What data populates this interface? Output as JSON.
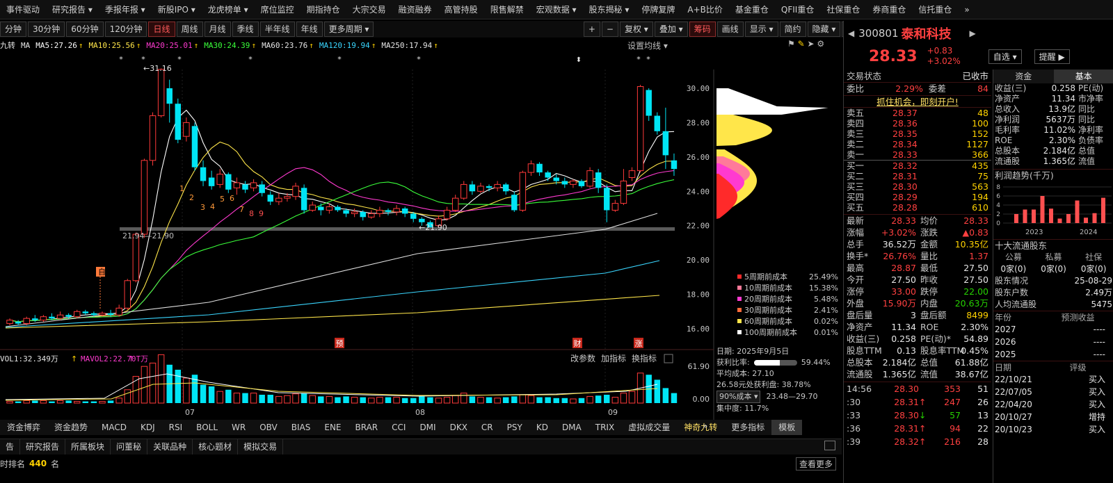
{
  "menu": [
    "事件驱动",
    "研究报告 ▾",
    "季报年报 ▾",
    "新股IPO ▾",
    "龙虎榜单 ▾",
    "席位监控",
    "期指持仓",
    "大宗交易",
    "融资融券",
    "高管持股",
    "限售解禁",
    "宏观数据 ▾",
    "股东揭秘 ▾",
    "停牌复牌",
    "A+B比价",
    "基金重仓",
    "QFII重仓",
    "社保重仓",
    "券商重仓",
    "信托重仓",
    "»"
  ],
  "periods": [
    "分钟",
    "30分钟",
    "60分钟",
    "120分钟",
    "日线",
    "周线",
    "月线",
    "季线",
    "半年线",
    "年线",
    "更多周期 ▾"
  ],
  "tools": [
    "+",
    "−",
    "复权 ▾",
    "叠加 ▾",
    "筹码",
    "画线",
    "显示 ▾",
    "简约",
    "隐藏 ▾",
    "⤡"
  ],
  "ma": {
    "prefix": "九转",
    "ma": "MA",
    "ma5": "MA5:27.26",
    "ma10": "MA10:25.56",
    "ma20": "MA20:25.01",
    "ma30": "MA30:24.39",
    "ma60": "MA60:23.76",
    "ma120": "MA120:19.94",
    "ma250": "MA250:17.94",
    "setup": "设置均线 ▾"
  },
  "chart_data": {
    "type": "candlestick",
    "y_ticks": [
      "30.00",
      "28.00",
      "26.00",
      "24.00",
      "22.00",
      "20.00",
      "18.00",
      "16.00"
    ],
    "x_ticks": [
      "07",
      "08",
      "09"
    ],
    "annotations": {
      "high": "31.16",
      "low": "21.90",
      "range": "21.94—21.90",
      "markers": [
        "预",
        "财",
        "涨"
      ],
      "self": "自",
      "nums": [
        "1",
        "2",
        "3",
        "4",
        "5",
        "6",
        "7",
        "8",
        "9"
      ]
    },
    "vol_label": "VOL1:32.349万",
    "mavol_label": "MAVOL2:22.70T万",
    "vol_ticks": [
      "61.90",
      "0.00"
    ],
    "vol_tools": [
      "改参数",
      "加指标",
      "换指标"
    ]
  },
  "chip_legend": [
    {
      "label": "5周期前成本",
      "value": "25.49%",
      "color": "#ff2a2a"
    },
    {
      "label": "10周期前成本",
      "value": "15.38%",
      "color": "#ff7a9a"
    },
    {
      "label": "20周期前成本",
      "value": "5.48%",
      "color": "#ff3ad0"
    },
    {
      "label": "30周期前成本",
      "value": "2.41%",
      "color": "#ff6a3a"
    },
    {
      "label": "60周期前成本",
      "value": "0.02%",
      "color": "#ffe64a"
    },
    {
      "label": "100周期前成本",
      "value": "0.01%",
      "color": "#ffffff"
    }
  ],
  "chip_info": {
    "date": "日期: 2025年9月5日",
    "profit_label": "获利比率:",
    "profit": "59.44%",
    "profit_pct": 0.5944,
    "avgcost": "平均成本: 27.10",
    "profit2": "26.58元处获利盘: 38.78%",
    "cost_sel": "90%成本 ▾",
    "cost_range": "23.48—29.70",
    "concentration": "集中度: 11.7%"
  },
  "indicators": [
    "资金博弈",
    "资金趋势",
    "MACD",
    "KDJ",
    "RSI",
    "BOLL",
    "WR",
    "OBV",
    "BIAS",
    "ENE",
    "BRAR",
    "CCI",
    "DMI",
    "DKX",
    "CR",
    "PSY",
    "KD",
    "DMA",
    "TRIX",
    "虚拟成交量",
    "神奇九转",
    "更多指标",
    "模板"
  ],
  "bottom_tabs": [
    "告",
    "研究报告",
    "所属板块",
    "问董秘",
    "关联品种",
    "核心题材",
    "模拟交易"
  ],
  "rank": {
    "label": "时排名",
    "value": "440",
    "unit": "名",
    "more": "查看更多"
  },
  "stock": {
    "code": "300801",
    "name": "泰和科技",
    "price": "28.33",
    "change": "+0.83",
    "pct": "+3.02%",
    "fav": "自选 ▾",
    "remind": "提醒 ▶"
  },
  "status": {
    "label": "交易状态",
    "value": "已收市"
  },
  "wb": {
    "wb_label": "委比",
    "wb": "2.29%",
    "wc_label": "委差",
    "wc": "84",
    "ad": "抓住机会，即刻开户!"
  },
  "asks": [
    [
      "卖五",
      "28.37",
      "48"
    ],
    [
      "卖四",
      "28.36",
      "100"
    ],
    [
      "卖三",
      "28.35",
      "152"
    ],
    [
      "卖二",
      "28.34",
      "1127"
    ],
    [
      "卖一",
      "28.33",
      "366"
    ]
  ],
  "bids": [
    [
      "买一",
      "28.32",
      "435"
    ],
    [
      "买二",
      "28.31",
      "75"
    ],
    [
      "买三",
      "28.30",
      "563"
    ],
    [
      "买四",
      "28.29",
      "194"
    ],
    [
      "买五",
      "28.28",
      "610"
    ]
  ],
  "quote": [
    [
      "最新",
      "28.33",
      "均价",
      "28.33"
    ],
    [
      "涨幅",
      "+3.02%",
      "涨跌",
      "▲0.83"
    ],
    [
      "总手",
      "36.52万",
      "金额",
      "10.35亿"
    ],
    [
      "换手*",
      "26.76%",
      "量比",
      "1.37"
    ],
    [
      "最高",
      "28.87",
      "最低",
      "27.50"
    ],
    [
      "今开",
      "27.50",
      "昨收",
      "27.50"
    ],
    [
      "涨停",
      "33.00",
      "跌停",
      "22.00"
    ],
    [
      "外盘",
      "15.90万",
      "内盘",
      "20.63万"
    ],
    [
      "盘后量",
      "3",
      "盘后额",
      "8499"
    ],
    [
      "净资产",
      "11.34",
      "ROE",
      "2.30%"
    ],
    [
      "收益(三)",
      "0.258",
      "PE(动)*",
      "54.89"
    ],
    [
      "股息TTM",
      "0.13",
      "股息率TTM",
      "0.45%"
    ],
    [
      "总股本",
      "2.184亿",
      "总值",
      "61.88亿"
    ],
    [
      "流通股",
      "1.365亿",
      "流值",
      "38.67亿"
    ]
  ],
  "ticks": [
    [
      "14:56",
      "28.30",
      "",
      "353",
      "51"
    ],
    [
      ":30",
      "28.31",
      "↑",
      "247",
      "26"
    ],
    [
      ":33",
      "28.30",
      "↓",
      "57",
      "13"
    ],
    [
      ":36",
      "28.31",
      "↑",
      "94",
      "22"
    ],
    [
      ":39",
      "28.32",
      "↑",
      "216",
      "28"
    ]
  ],
  "tabs2": [
    "资金",
    "基本"
  ],
  "basics": [
    [
      "收益(三)",
      "0.258",
      "PE(动)"
    ],
    [
      "净资产",
      "11.34",
      "市净率"
    ],
    [
      "总收入",
      "13.9亿",
      "同比"
    ],
    [
      "净利润",
      "5637万",
      "同比"
    ],
    [
      "毛利率",
      "11.02%",
      "净利率"
    ],
    [
      "ROE",
      "2.30%",
      "负债率"
    ],
    [
      "总股本",
      "2.184亿",
      "总值"
    ],
    [
      "流通股",
      "1.365亿",
      "流值"
    ]
  ],
  "profit_chart": {
    "title": "利润趋势(千万)",
    "years": [
      "2023",
      "2024"
    ],
    "y": [
      "8",
      "6",
      "4",
      "2",
      "0"
    ],
    "values": [
      2.0,
      3.0,
      3.0,
      6.0,
      3.2,
      1.0,
      2.0,
      5.0,
      1.2,
      2.2,
      5.6
    ]
  },
  "holders": {
    "title": "十大流通股东",
    "cols": [
      "公募",
      "私募",
      "社保"
    ],
    "vals": [
      "0家(0)",
      "0家(0)",
      "0家(0)"
    ],
    "rows": [
      [
        "股东情况",
        "25-08-29"
      ],
      [
        "股东户数",
        "2.49万"
      ],
      [
        "人均流通股",
        "5475"
      ]
    ]
  },
  "forecast": {
    "h1": "年份",
    "h2": "预测收益",
    "rows": [
      [
        "2027",
        "----"
      ],
      [
        "2026",
        "----"
      ],
      [
        "2025",
        "----"
      ]
    ]
  },
  "rating": {
    "h1": "日期",
    "h2": "评级",
    "rows": [
      [
        "22/10/21",
        "买入"
      ],
      [
        "22/07/05",
        "买入"
      ],
      [
        "22/04/20",
        "买入"
      ],
      [
        "20/10/27",
        "增持"
      ],
      [
        "20/10/23",
        "买入"
      ]
    ]
  }
}
